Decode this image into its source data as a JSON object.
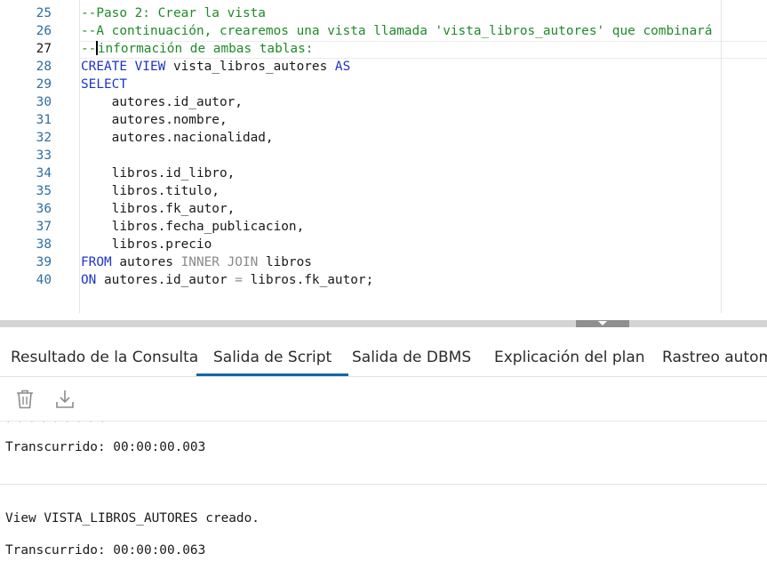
{
  "editor": {
    "lines": [
      {
        "num": "25",
        "parts": [
          {
            "t": "--Paso 2: Crear la vista",
            "c": "cm"
          }
        ]
      },
      {
        "num": "26",
        "parts": [
          {
            "t": "--A continuación, crearemos una vista llamada 'vista_libros_autores' que combinará",
            "c": "cm"
          }
        ]
      },
      {
        "num": "27",
        "current": true,
        "parts": [
          {
            "t": "--",
            "c": "cm"
          },
          {
            "caret": true
          },
          {
            "t": "información de ambas tablas:",
            "c": "cm"
          }
        ]
      },
      {
        "num": "28",
        "parts": [
          {
            "t": "CREATE VIEW",
            "c": "kw"
          },
          {
            "t": " vista_libros_autores ",
            "c": ""
          },
          {
            "t": "AS",
            "c": "kw"
          }
        ]
      },
      {
        "num": "29",
        "parts": [
          {
            "t": "SELECT",
            "c": "kw"
          }
        ]
      },
      {
        "num": "30",
        "parts": [
          {
            "t": "    autores.id_autor,",
            "c": ""
          }
        ]
      },
      {
        "num": "31",
        "parts": [
          {
            "t": "    autores.nombre,",
            "c": ""
          }
        ]
      },
      {
        "num": "32",
        "parts": [
          {
            "t": "    autores.nacionalidad,",
            "c": ""
          }
        ]
      },
      {
        "num": "33",
        "parts": [
          {
            "t": "",
            "c": ""
          }
        ]
      },
      {
        "num": "34",
        "parts": [
          {
            "t": "    libros.id_libro,",
            "c": ""
          }
        ]
      },
      {
        "num": "35",
        "parts": [
          {
            "t": "    libros.titulo,",
            "c": ""
          }
        ]
      },
      {
        "num": "36",
        "parts": [
          {
            "t": "    libros.fk_autor,",
            "c": ""
          }
        ]
      },
      {
        "num": "37",
        "parts": [
          {
            "t": "    libros.fecha_publicacion,",
            "c": ""
          }
        ]
      },
      {
        "num": "38",
        "parts": [
          {
            "t": "    libros.precio",
            "c": ""
          }
        ]
      },
      {
        "num": "39",
        "parts": [
          {
            "t": "FROM",
            "c": "kw"
          },
          {
            "t": " autores ",
            "c": ""
          },
          {
            "t": "INNER JOIN",
            "c": "kw2"
          },
          {
            "t": " libros",
            "c": ""
          }
        ]
      },
      {
        "num": "40",
        "parts": [
          {
            "t": "ON",
            "c": "kw"
          },
          {
            "t": " autores.id_autor ",
            "c": ""
          },
          {
            "t": "=",
            "c": "kw2"
          },
          {
            "t": " libros.fk_autor;",
            "c": ""
          }
        ]
      }
    ]
  },
  "tabs": [
    {
      "label": "Resultado de la Consulta",
      "name": "tab-resultado-consulta"
    },
    {
      "label": "Salida de Script",
      "name": "tab-salida-script",
      "active": true
    },
    {
      "label": "Salida de DBMS",
      "name": "tab-salida-dbms"
    },
    {
      "label": "Explicación del plan",
      "name": "tab-explicacion-plan"
    },
    {
      "label": "Rastreo automá",
      "name": "tab-rastreo-automatico"
    }
  ],
  "toolbar": {
    "clear_icon": "trash-icon",
    "save_icon": "download-icon"
  },
  "output": {
    "elapsed_1": "Transcurrido: 00:00:00.003",
    "view_created": "View VISTA_LIBROS_AUTORES creado.",
    "elapsed_2": "Transcurrido: 00:00:00.063"
  }
}
